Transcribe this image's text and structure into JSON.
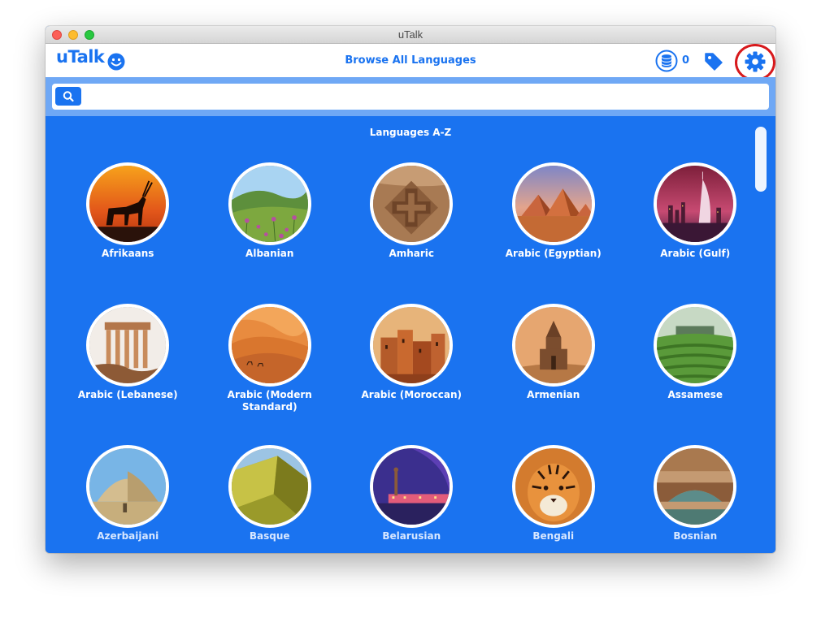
{
  "window": {
    "title": "uTalk"
  },
  "header": {
    "logo_text": "uTalk",
    "title": "Browse All Languages",
    "coins_count": "0"
  },
  "search": {
    "value": "",
    "placeholder": ""
  },
  "section": {
    "title": "Languages A-Z"
  },
  "languages": [
    {
      "name": "Afrikaans",
      "icon": "oryx-sunset-image"
    },
    {
      "name": "Albanian",
      "icon": "meadow-hills-image"
    },
    {
      "name": "Amharic",
      "icon": "rock-church-image"
    },
    {
      "name": "Arabic (Egyptian)",
      "icon": "pyramids-image"
    },
    {
      "name": "Arabic (Gulf)",
      "icon": "burj-skyline-image"
    },
    {
      "name": "Arabic (Lebanese)",
      "icon": "roman-columns-image"
    },
    {
      "name": "Arabic (Modern Standard)",
      "icon": "desert-dunes-image"
    },
    {
      "name": "Arabic (Moroccan)",
      "icon": "kasbah-image"
    },
    {
      "name": "Armenian",
      "icon": "monastery-image"
    },
    {
      "name": "Assamese",
      "icon": "tea-plantation-image"
    },
    {
      "name": "Azerbaijani",
      "icon": "dome-image"
    },
    {
      "name": "Basque",
      "icon": "golden-facade-image"
    },
    {
      "name": "Belarusian",
      "icon": "night-statue-image"
    },
    {
      "name": "Bengali",
      "icon": "tiger-image"
    },
    {
      "name": "Bosnian",
      "icon": "old-bridge-image"
    }
  ],
  "colors": {
    "accent": "#1a73f0",
    "searchbar": "#6fa8f5",
    "highlight": "#d7191c"
  }
}
